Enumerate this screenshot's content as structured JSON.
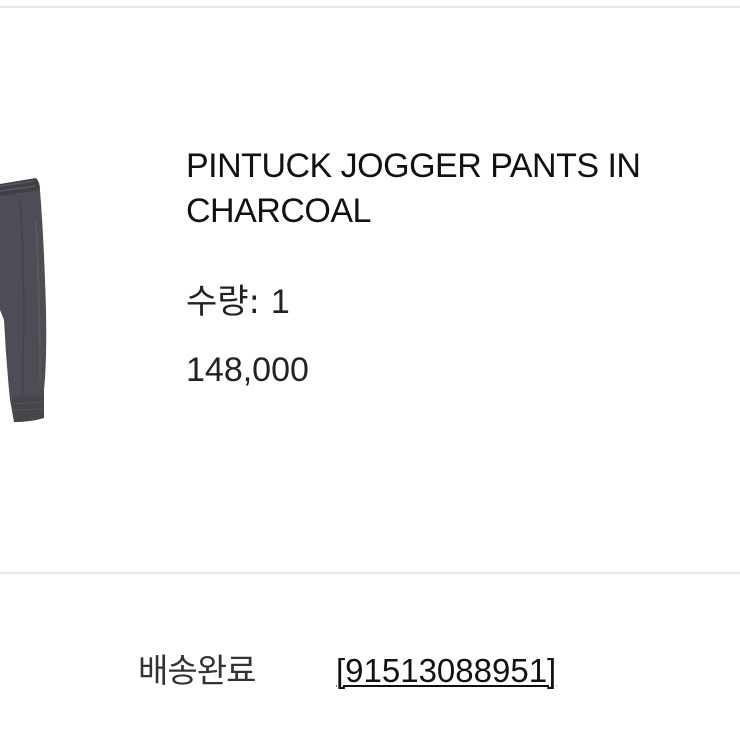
{
  "product": {
    "name": "PINTUCK JOGGER PANTS IN CHARCOAL",
    "quantity_label": "수량:",
    "quantity_value": "1",
    "price": "148,000",
    "image_icon": "charcoal-jogger-pants-thumbnail",
    "image_color": "#4d4e55"
  },
  "shipping": {
    "status": "배송완료",
    "tracking_number": "[91513088951]"
  },
  "colors": {
    "divider": "#e6e6e6",
    "text": "#111111"
  }
}
